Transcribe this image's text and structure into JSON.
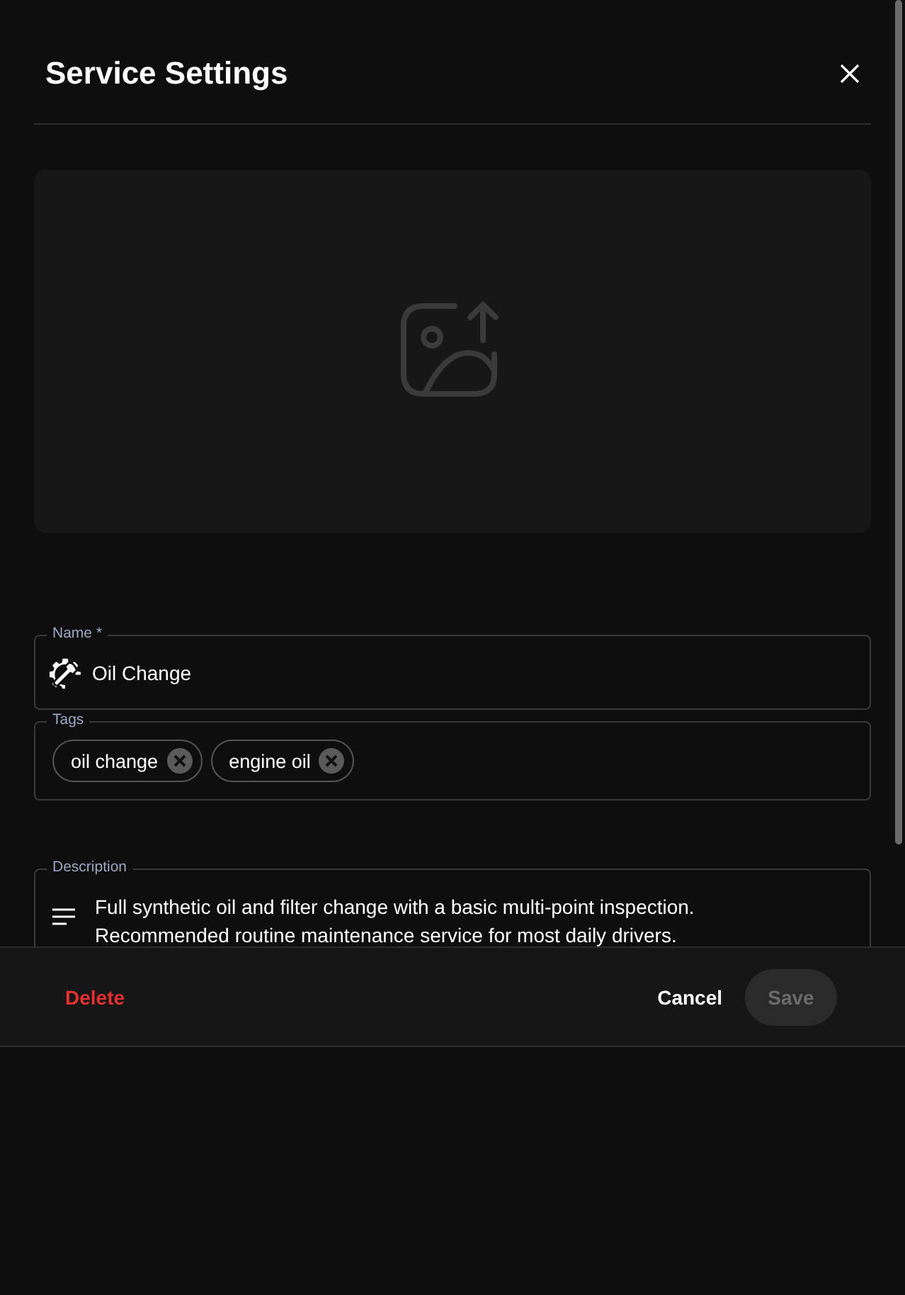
{
  "dialog": {
    "title": "Service Settings"
  },
  "name_field": {
    "label": "Name",
    "required_mark": "*",
    "value": "Oil Change"
  },
  "tags_field": {
    "label": "Tags",
    "tags": [
      {
        "label": "oil change"
      },
      {
        "label": "engine oil"
      }
    ]
  },
  "description_field": {
    "label": "Description",
    "value": "Full synthetic oil and filter change with a basic multi-point inspection. Recommended routine maintenance service for most daily drivers."
  },
  "footer": {
    "buttons": [
      {
        "label": "Delete",
        "kind": "danger"
      },
      {
        "label": "Cancel",
        "kind": "plain"
      },
      {
        "label": "Save",
        "kind": "primary",
        "disabled": true
      }
    ]
  }
}
